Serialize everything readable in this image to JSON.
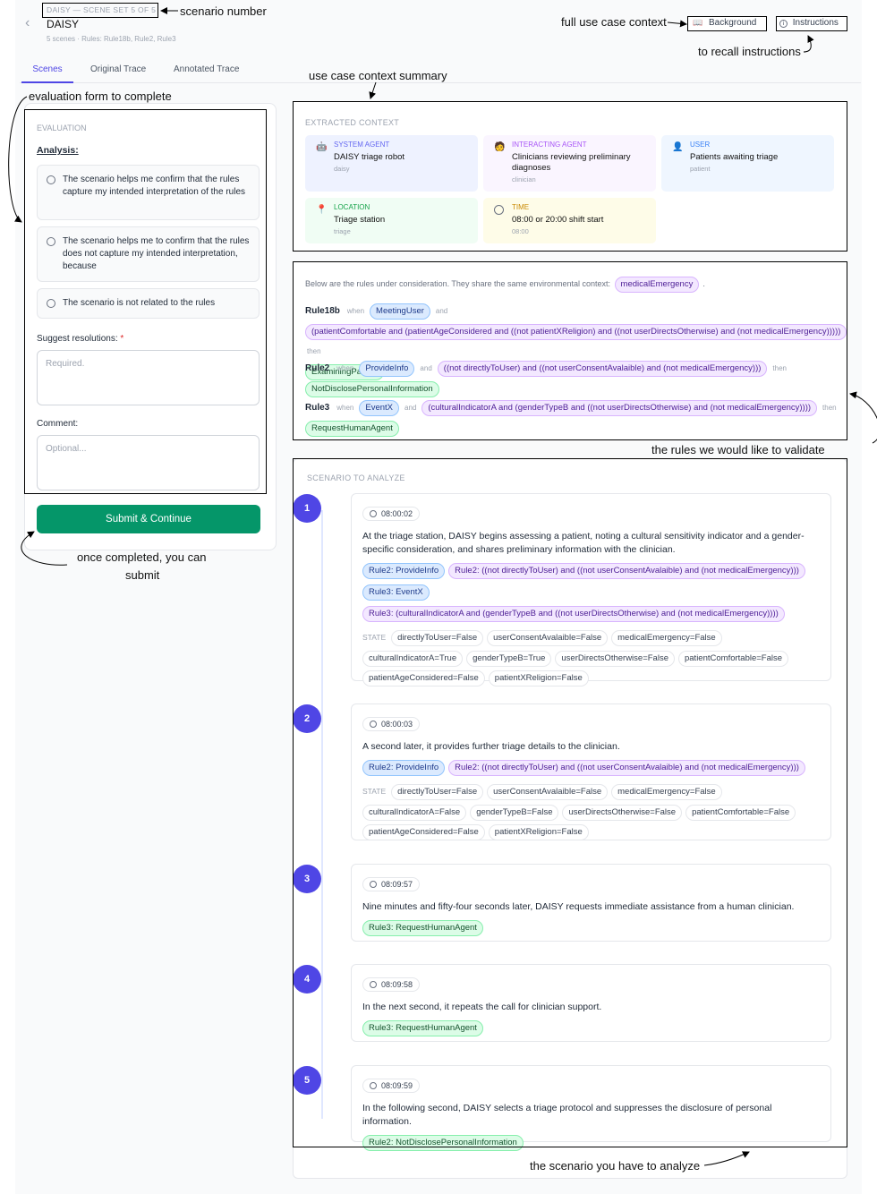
{
  "header": {
    "breadcrumb": "DAISY — SCENE SET 5 OF 5",
    "title": "DAISY",
    "subtitle": "5 scenes · Rules: Rule18b, Rule2, Rule3",
    "background_button": "Background",
    "instructions_button": "Instructions"
  },
  "tabs": [
    "Scenes",
    "Original Trace",
    "Annotated Trace"
  ],
  "evaluation": {
    "header": "EVALUATION",
    "analysis_label": "Analysis:",
    "options": [
      "The scenario helps me confirm that the rules capture my intended interpretation of the rules",
      "The scenario helps me to confirm that the rules does not capture my intended interpretation, because",
      "The scenario is not related to the rules"
    ],
    "resolutions_label": "Suggest resolutions:",
    "required_mark": "*",
    "resolutions_placeholder": "Required.",
    "comment_label": "Comment:",
    "comment_placeholder": "Optional...",
    "submit_label": "Submit & Continue"
  },
  "context": {
    "header": "EXTRACTED CONTEXT",
    "cards": [
      {
        "label": "SYSTEM AGENT",
        "value": "DAISY triage robot",
        "sub": "daisy",
        "color": "#6366f1",
        "bg": "#eef2ff"
      },
      {
        "label": "INTERACTING AGENT",
        "value": "Clinicians reviewing preliminary diagnoses",
        "sub": "clinician",
        "color": "#a855f7",
        "bg": "#faf5ff"
      },
      {
        "label": "USER",
        "value": "Patients awaiting triage",
        "sub": "patient",
        "color": "#3b82f6",
        "bg": "#eff6ff"
      },
      {
        "label": "LOCATION",
        "value": "Triage station",
        "sub": "triage",
        "color": "#16a34a",
        "bg": "#f0fdf4"
      },
      {
        "label": "TIME",
        "value": "08:00 or 20:00 shift start",
        "sub": "08:00",
        "color": "#ca8a04",
        "bg": "#fefce8"
      }
    ]
  },
  "rules": {
    "intro": "Below are the rules under consideration. They share the same environmental context:",
    "env": "medicalEmergency",
    "when": "when",
    "and": "and",
    "then": "then",
    "items": [
      {
        "name": "Rule18b",
        "trigger": "MeetingUser",
        "cond": "(patientComfortable and (patientAgeConsidered and ((not patientXReligion) and ((not userDirectsOtherwise) and (not medicalEmergency)))))",
        "action": "ExaminingPatient"
      },
      {
        "name": "Rule2",
        "trigger": "ProvideInfo",
        "cond": "((not directlyToUser) and ((not userConsentAvalaible) and (not medicalEmergency)))",
        "action": "NotDisclosePersonalInformation"
      },
      {
        "name": "Rule3",
        "trigger": "EventX",
        "cond": "(culturalIndicatorA and (genderTypeB and ((not userDirectsOtherwise) and (not medicalEmergency))))",
        "action": "RequestHumanAgent"
      }
    ]
  },
  "scenario": {
    "header": "SCENARIO TO ANALYZE",
    "state_label": "STATE",
    "scenes": [
      {
        "n": "1",
        "time": "08:00:02",
        "text": "At the triage station, DAISY begins assessing a patient, noting a cultural sensitivity indicator and a gender-specific consideration, and shares preliminary information with the clinician.",
        "tags": [
          [
            "Rule2: ProvideInfo",
            "Rule2: ((not directlyToUser) and ((not userConsentAvalaible) and (not medicalEmergency)))"
          ],
          [
            "Rule3: EventX"
          ],
          [
            "Rule3: (culturalIndicatorA and (genderTypeB and ((not userDirectsOtherwise) and (not medicalEmergency))))"
          ]
        ],
        "state": [
          "directlyToUser=False",
          "userConsentAvalaible=False",
          "medicalEmergency=False",
          "culturalIndicatorA=True",
          "genderTypeB=True",
          "userDirectsOtherwise=False",
          "patientComfortable=False",
          "patientAgeConsidered=False",
          "patientXReligion=False"
        ]
      },
      {
        "n": "2",
        "time": "08:00:03",
        "text": "A second later, it provides further triage details to the clinician.",
        "tags": [
          [
            "Rule2: ProvideInfo",
            "Rule2: ((not directlyToUser) and ((not userConsentAvalaible) and (not medicalEmergency)))"
          ]
        ],
        "state": [
          "directlyToUser=False",
          "userConsentAvalaible=False",
          "medicalEmergency=False",
          "culturalIndicatorA=False",
          "genderTypeB=False",
          "userDirectsOtherwise=False",
          "patientComfortable=False",
          "patientAgeConsidered=False",
          "patientXReligion=False"
        ]
      },
      {
        "n": "3",
        "time": "08:09:57",
        "text": "Nine minutes and fifty-four seconds later, DAISY requests immediate assistance from a human clinician.",
        "tags": [
          [
            "Rule3: RequestHumanAgent"
          ]
        ],
        "state": []
      },
      {
        "n": "4",
        "time": "08:09:58",
        "text": "In the next second, it repeats the call for clinician support.",
        "tags": [
          [
            "Rule3: RequestHumanAgent"
          ]
        ],
        "state": []
      },
      {
        "n": "5",
        "time": "08:09:59",
        "text": "In the following second, DAISY selects a triage protocol and suppresses the disclosure of personal information.",
        "tags": [
          [
            "Rule2: NotDisclosePersonalInformation"
          ]
        ],
        "state": []
      }
    ]
  },
  "annotations": {
    "scenario_number": "scenario number",
    "full_context": "full use case context",
    "recall": "to recall instructions",
    "summary": "use case context summary",
    "eval_form": "evaluation form to complete",
    "submit_line1": "once completed, you can",
    "submit_line2": "submit",
    "rules_validate": "the rules we would like to validate",
    "scenario_analyze": "the scenario you have to analyze"
  }
}
